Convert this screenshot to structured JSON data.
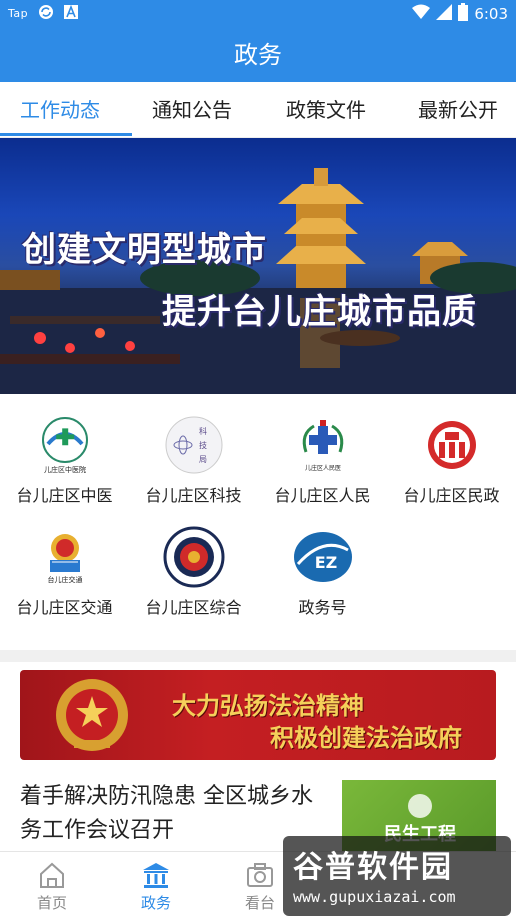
{
  "status_bar": {
    "carrier": "Tap",
    "time": "6:03"
  },
  "header": {
    "title": "政务"
  },
  "tabs": [
    {
      "label": "工作动态",
      "active": true
    },
    {
      "label": "通知公告",
      "active": false
    },
    {
      "label": "政策文件",
      "active": false
    },
    {
      "label": "最新公开",
      "active": false
    }
  ],
  "banner": {
    "line1": "创建文明型城市",
    "line2": "提升台儿庄城市品质"
  },
  "departments": [
    {
      "label": "台儿庄区中医",
      "icon": "hospital-logo-icon",
      "logo_text": "儿庄区中医院"
    },
    {
      "label": "台儿庄区科技",
      "icon": "science-bureau-logo-icon",
      "logo_text": "科技局"
    },
    {
      "label": "台儿庄区人民",
      "icon": "peoples-hospital-logo-icon",
      "logo_text": "儿庄区人民医"
    },
    {
      "label": "台儿庄区民政",
      "icon": "civil-affairs-logo-icon",
      "logo_text": ""
    },
    {
      "label": "台儿庄区交通",
      "icon": "transport-logo-icon",
      "logo_text": "台儿庄交通"
    },
    {
      "label": "台儿庄区综合",
      "icon": "law-enforcement-logo-icon",
      "logo_text": ""
    },
    {
      "label": "政务号",
      "icon": "ez-logo-icon",
      "logo_text": "EZ"
    }
  ],
  "promo": {
    "line1": "大力弘扬法治精神",
    "line2": "积极创建法治政府"
  },
  "news": [
    {
      "title": "着手解决防汛隐患 全区城乡水务工作会议召开",
      "thumb_text": "民生工程"
    }
  ],
  "bottom_nav": [
    {
      "label": "首页",
      "icon": "home-icon",
      "active": false
    },
    {
      "label": "政务",
      "icon": "government-icon",
      "active": true
    },
    {
      "label": "看台",
      "icon": "camera-icon",
      "active": false
    }
  ],
  "watermark": {
    "title": "谷普软件园",
    "url": "www.gupuxiazai.com"
  },
  "colors": {
    "primary": "#2e8be6",
    "promo_red": "#c41f22",
    "promo_gold": "#f5d05a"
  }
}
